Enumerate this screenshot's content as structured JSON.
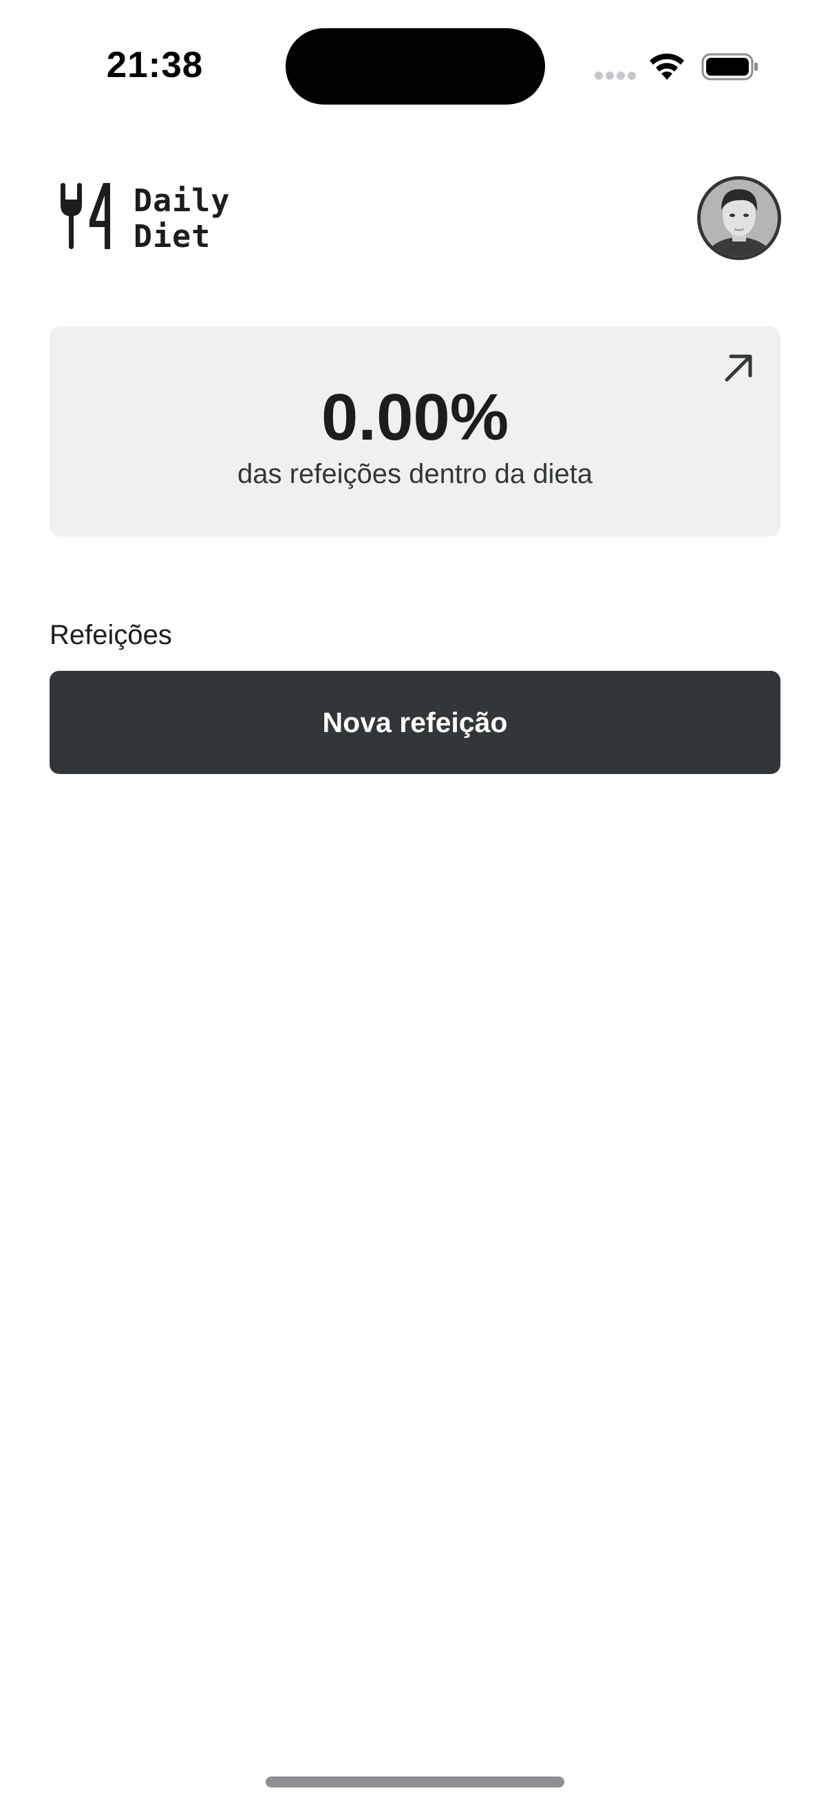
{
  "status_bar": {
    "time": "21:38",
    "icons": [
      "cellular-signal-icon",
      "wifi-icon",
      "battery-icon"
    ]
  },
  "header": {
    "logo_line1": "Daily",
    "logo_line2": "Diet",
    "logo_icon": "fork-knife-icon",
    "avatar": "user-avatar"
  },
  "stats": {
    "percent": "0.00%",
    "caption": "das refeições dentro da dieta",
    "arrow_icon": "arrow-up-right-icon"
  },
  "meals": {
    "title": "Refeições",
    "new_button_label": "Nova refeição"
  },
  "colors": {
    "background": "#FFFFFF",
    "card": "#EFF0F0",
    "button": "#333638",
    "text_dark": "#1B1D1E",
    "text_secondary": "#333638"
  }
}
